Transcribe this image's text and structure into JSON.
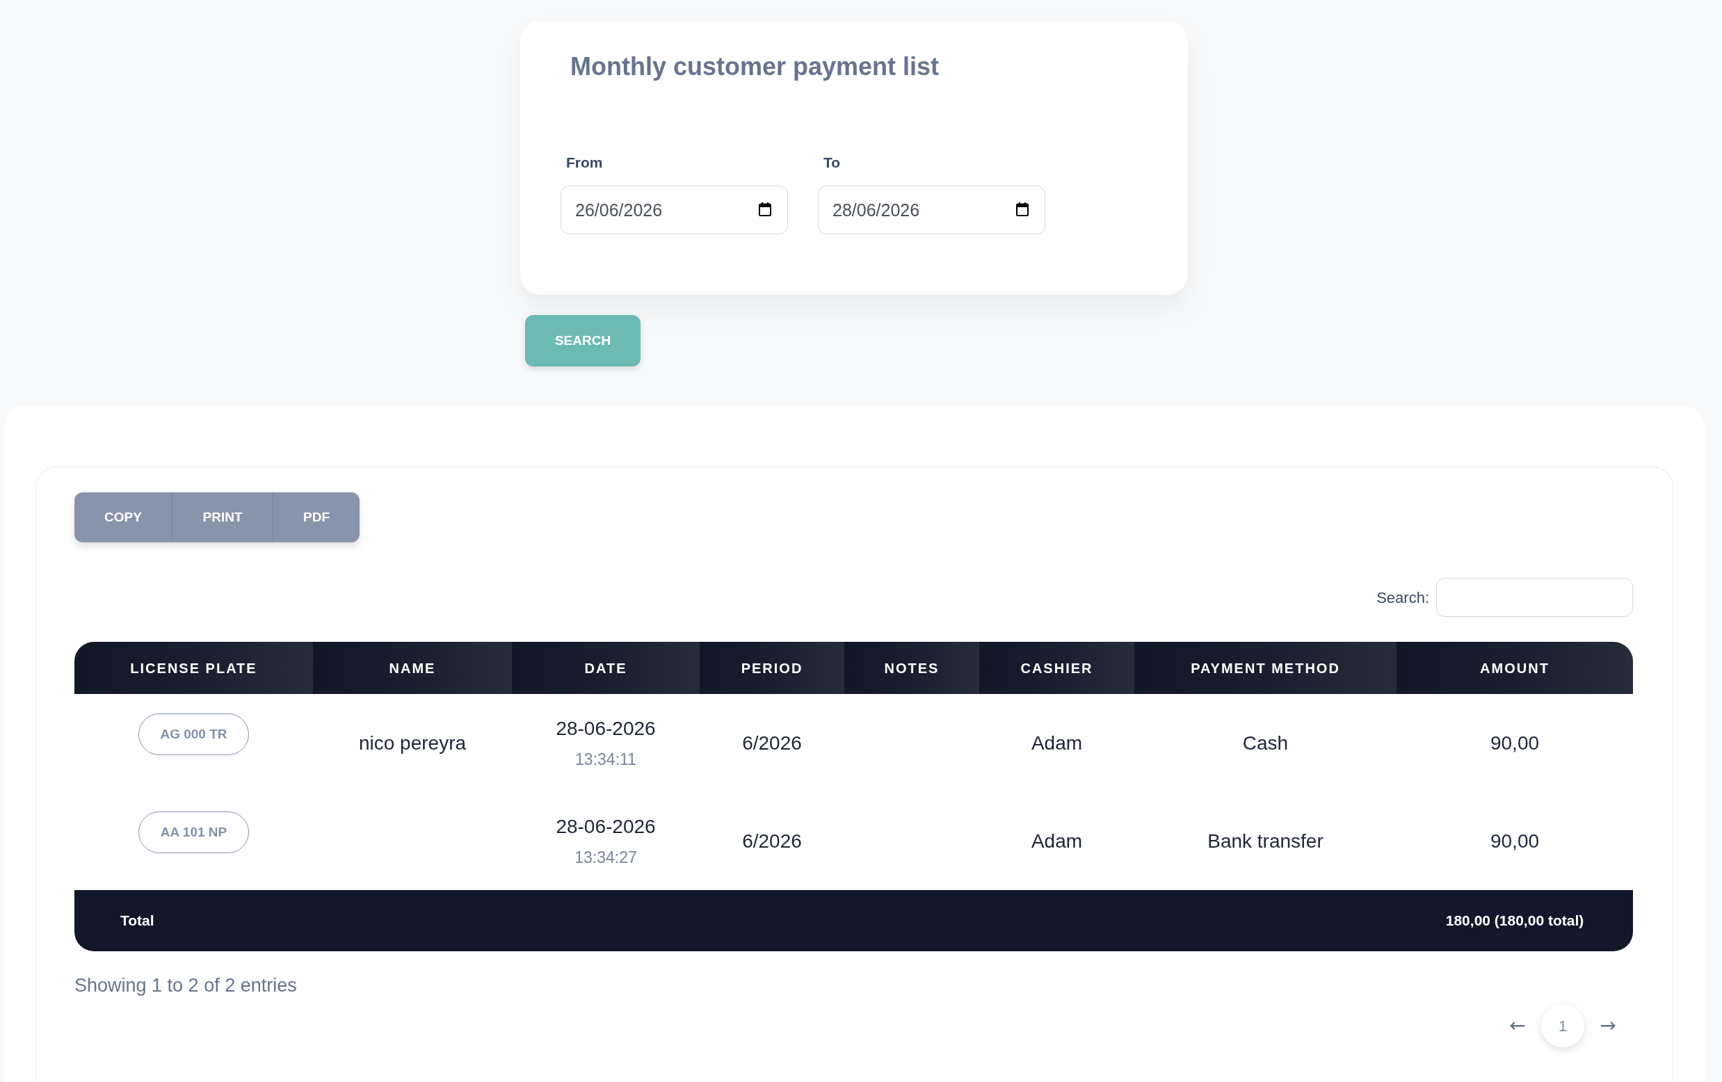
{
  "filter_card": {
    "title": "Monthly customer payment list",
    "fields": [
      {
        "label": "From",
        "value": "26/06/2026"
      },
      {
        "label": "To",
        "value": "28/06/2026"
      }
    ]
  },
  "search_button": "SEARCH",
  "export_buttons": [
    "COPY",
    "PRINT",
    "PDF"
  ],
  "table_search": {
    "label": "Search:"
  },
  "table": {
    "columns": [
      "LICENSE PLATE",
      "NAME",
      "DATE",
      "PERIOD",
      "NOTES",
      "CASHIER",
      "PAYMENT METHOD",
      "AMOUNT"
    ],
    "rows": [
      {
        "license_plate": "AG 000 TR",
        "name": "nico pereyra",
        "date": "28-06-2026",
        "time": "13:34:11",
        "period": "6/2026",
        "cashier": "Adam",
        "payment_method": "Cash",
        "amount": "90,00"
      },
      {
        "license_plate": "AA 101 NP",
        "date": "28-06-2026",
        "time": "13:34:27",
        "period": "6/2026",
        "cashier": "Adam",
        "payment_method": "Bank transfer",
        "amount": "90,00"
      }
    ],
    "footer": {
      "label": "Total",
      "amount": "180,00 (180,00 total)"
    }
  },
  "info": "Showing 1 to 2 of 2 entries",
  "pagination": {
    "previous": "←",
    "pages": [
      {
        "label": "1",
        "selected": true
      }
    ],
    "next": "→"
  }
}
